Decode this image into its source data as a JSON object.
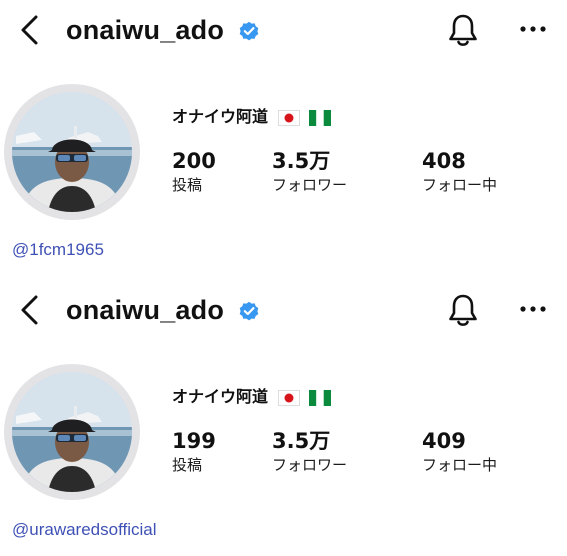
{
  "panels": [
    {
      "username": "onaiwu_ado",
      "display_name": "オナイウ阿道",
      "flags": [
        "japan-flag",
        "nigeria-flag"
      ],
      "stats": {
        "posts": {
          "value": "200",
          "label": "投稿"
        },
        "followers": {
          "value": "3.5万",
          "label": "フォロワー"
        },
        "following": {
          "value": "408",
          "label": "フォロー中"
        }
      },
      "handle": "@1fcm1965"
    },
    {
      "username": "onaiwu_ado",
      "display_name": "オナイウ阿道",
      "flags": [
        "japan-flag",
        "nigeria-flag"
      ],
      "stats": {
        "posts": {
          "value": "199",
          "label": "投稿"
        },
        "followers": {
          "value": "3.5万",
          "label": "フォロワー"
        },
        "following": {
          "value": "409",
          "label": "フォロー中"
        }
      },
      "handle": "@urawaredsofficial"
    }
  ],
  "colors": {
    "verified": "#3897f0",
    "handle": "#3f51b5",
    "ring": "#e3e3e6"
  },
  "icons": [
    "chevron-left-icon",
    "verified-badge-icon",
    "bell-icon",
    "more-icon"
  ]
}
